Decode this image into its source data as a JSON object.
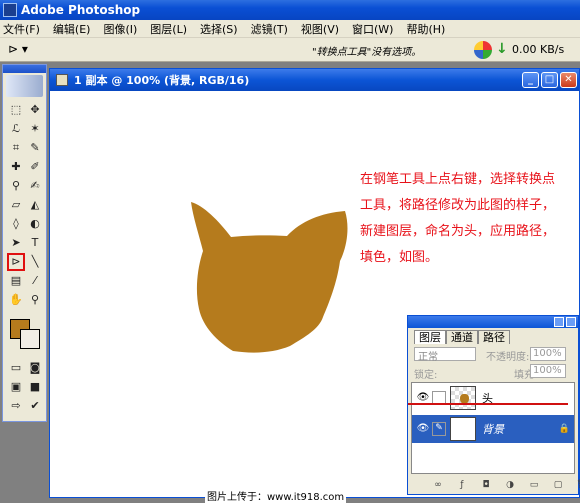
{
  "app": {
    "title": "Adobe Photoshop"
  },
  "menu": [
    "文件(F)",
    "编辑(E)",
    "图像(I)",
    "图层(L)",
    "选择(S)",
    "滤镜(T)",
    "视图(V)",
    "窗口(W)",
    "帮助(H)"
  ],
  "options_bar": {
    "message": "\"转换点工具\"没有选项。",
    "network_speed": "0.00 KB/s",
    "arrow_symbol": "↓"
  },
  "document": {
    "title": "1 副本 @ 100% (背景, RGB/16)",
    "instruction": "在钢笔工具上点右键，选择转换点工具，将路径修改为此图的样子，新建图层，命名为头，应用路径，填色，如图。"
  },
  "colors": {
    "foreground": "#b57b1d",
    "background": "#f1ede6",
    "shape_fill": "#b57b1d",
    "instruction_text": "#e8121a"
  },
  "layers_panel": {
    "tabs": [
      "图层",
      "通道",
      "路径"
    ],
    "blend_mode": "正常",
    "opacity_label": "不透明度:",
    "opacity": "100%",
    "lock_label": "锁定:",
    "fill_label": "填充:",
    "fill": "100%",
    "layers": [
      {
        "name": "头",
        "selected": false
      },
      {
        "name": "背景",
        "selected": true
      }
    ]
  },
  "watermark": "图片上传于：www.it918.com"
}
